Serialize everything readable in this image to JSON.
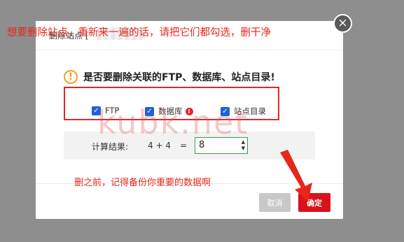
{
  "dialog": {
    "title": "删除站点 [",
    "close_symbol": "×"
  },
  "annotations": {
    "top": "想要删除站点，重新来一遍的话，请把它们都勾选，删干净",
    "bottom": "删之前，记得备份你重要的数据啊"
  },
  "warning": {
    "icon_name": "warning-icon",
    "icon_symbol": "!",
    "text": "是否要删除关联的FTP、数据库、站点目录!"
  },
  "options": [
    {
      "label": "FTP",
      "checked": true
    },
    {
      "label": "数据库",
      "checked": true,
      "info": "i"
    },
    {
      "label": "站点目录",
      "checked": true
    }
  ],
  "check_symbol": "✓",
  "calc": {
    "label": "计算结果:",
    "expression": "4 + 4",
    "equals": "=",
    "answer": "8",
    "spin_up": "▲",
    "spin_down": "▼"
  },
  "watermark": "kubk.net",
  "buttons": {
    "cancel": "取消",
    "confirm": "确定"
  },
  "colors": {
    "accent_red": "#e4262c",
    "checkbox_blue": "#1e62d8",
    "warning_orange": "#f0a020",
    "confirm_red": "#d9121b"
  }
}
